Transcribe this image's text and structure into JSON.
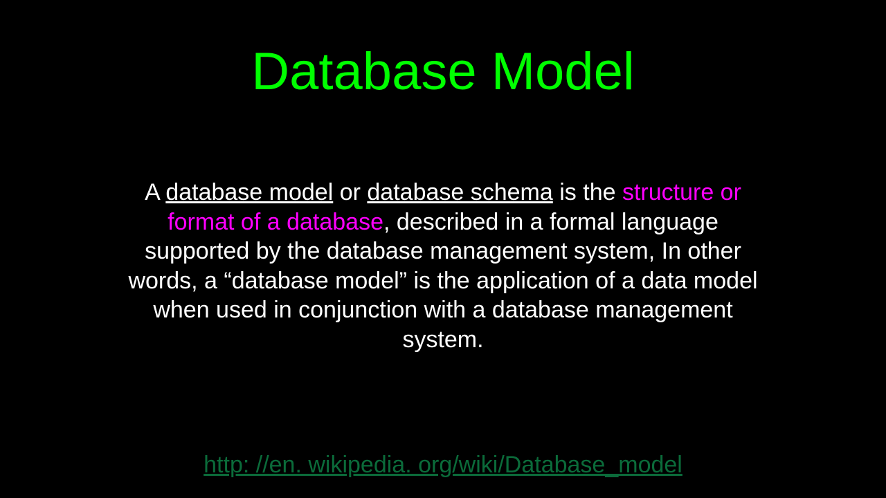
{
  "title": "Database Model",
  "body": {
    "t1": "A ",
    "u1": "database model",
    "t2": " or ",
    "u2": "database schema",
    "t3": " is the ",
    "m1": "structure or format of a database",
    "t4": ", described in a formal language supported by the database management system, In other words, a “database model” is the application of a data model when used in conjunction with a database management system."
  },
  "source_url": "http: //en. wikipedia. org/wiki/Database_model"
}
